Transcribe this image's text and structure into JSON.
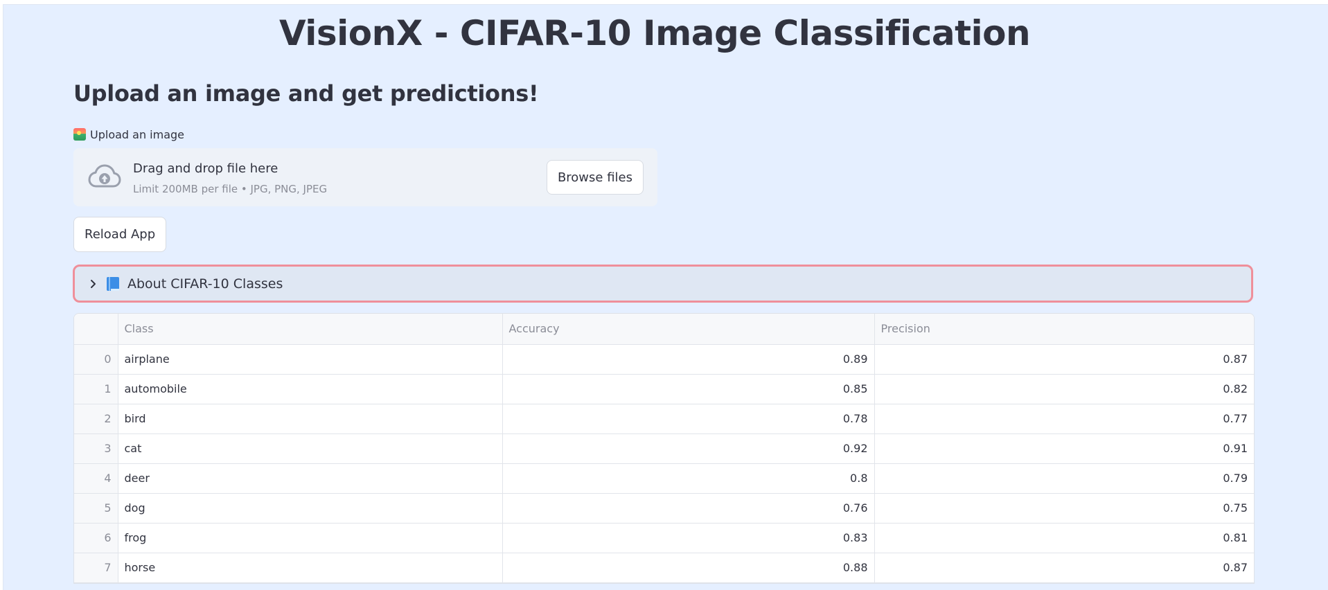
{
  "page": {
    "title": "VisionX - CIFAR-10 Image Classification",
    "subtitle": "Upload an image and get predictions!"
  },
  "uploader": {
    "label": "Upload an image",
    "label_icon": "framed-picture-icon",
    "drop_title": "Drag and drop file here",
    "drop_limit": "Limit 200MB per file • JPG, PNG, JPEG",
    "browse_label": "Browse files",
    "icon": "cloud-upload-icon"
  },
  "actions": {
    "reload_label": "Reload App"
  },
  "expander": {
    "label": "About CIFAR-10 Classes",
    "icon": "blue-book-icon",
    "state": "collapsed",
    "chevron_icon": "chevron-right-icon"
  },
  "table": {
    "columns": [
      "",
      "Class",
      "Accuracy",
      "Precision"
    ],
    "rows": [
      {
        "index": "0",
        "class": "airplane",
        "accuracy": "0.89",
        "precision": "0.87"
      },
      {
        "index": "1",
        "class": "automobile",
        "accuracy": "0.85",
        "precision": "0.82"
      },
      {
        "index": "2",
        "class": "bird",
        "accuracy": "0.78",
        "precision": "0.77"
      },
      {
        "index": "3",
        "class": "cat",
        "accuracy": "0.92",
        "precision": "0.91"
      },
      {
        "index": "4",
        "class": "deer",
        "accuracy": "0.8",
        "precision": "0.79"
      },
      {
        "index": "5",
        "class": "dog",
        "accuracy": "0.76",
        "precision": "0.75"
      },
      {
        "index": "6",
        "class": "frog",
        "accuracy": "0.83",
        "precision": "0.81"
      },
      {
        "index": "7",
        "class": "horse",
        "accuracy": "0.88",
        "precision": "0.87"
      }
    ]
  },
  "colors": {
    "app_background": "#e5efff",
    "text": "#31333f",
    "muted_text": "#8b8d97",
    "expander_border": "#ef8f9a",
    "dropzone_background": "#eef2f8"
  }
}
